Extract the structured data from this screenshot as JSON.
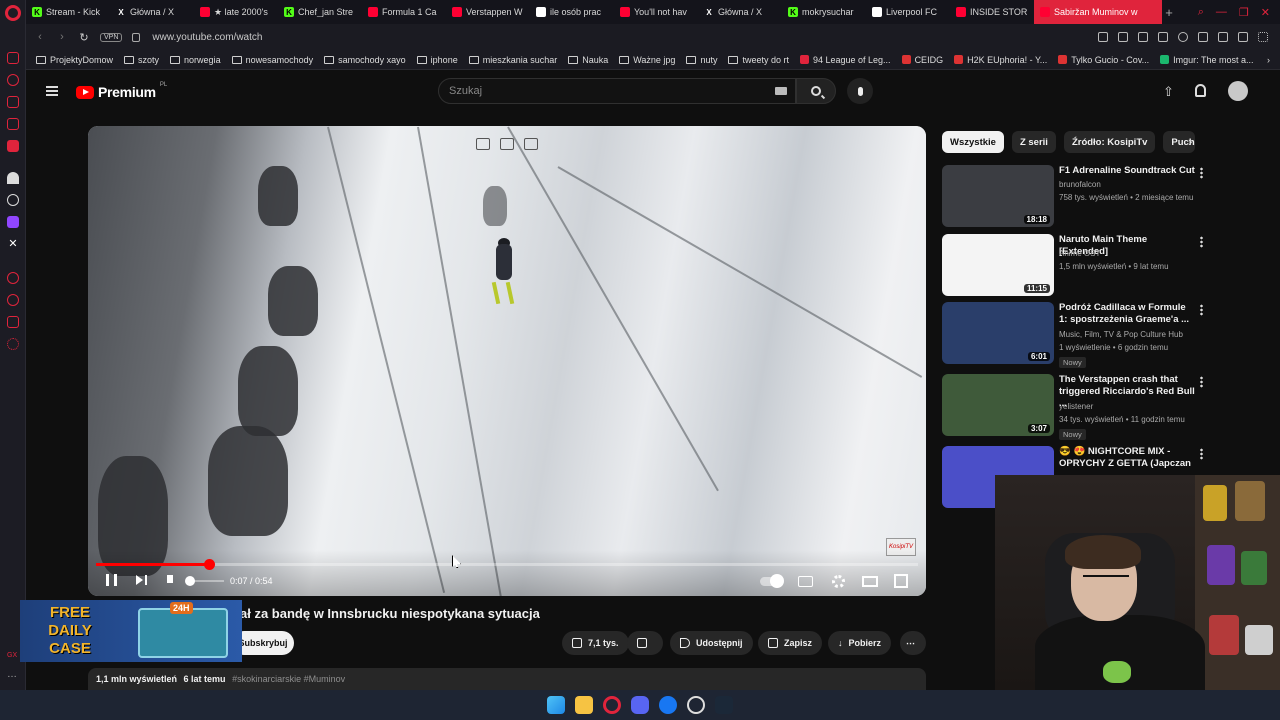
{
  "browser": {
    "tabs": [
      {
        "title": "Stream - Kick",
        "icon": "kick",
        "color": "#53fc18"
      },
      {
        "title": "Główna / X",
        "icon": "x",
        "color": "#ffffff"
      },
      {
        "title": "★ late 2000's",
        "icon": "youtube",
        "color": "#ff0033"
      },
      {
        "title": "Chef_jan Stre",
        "icon": "kick",
        "color": "#53fc18"
      },
      {
        "title": "Formula 1 Ca",
        "icon": "youtube",
        "color": "#ff0033"
      },
      {
        "title": "Verstappen W",
        "icon": "youtube",
        "color": "#ff0033"
      },
      {
        "title": "ile osób prac",
        "icon": "google",
        "color": "#ffffff"
      },
      {
        "title": "You'll not hav",
        "icon": "youtube",
        "color": "#ff0033"
      },
      {
        "title": "Główna / X",
        "icon": "x",
        "color": "#ffffff"
      },
      {
        "title": "mokrysuchar",
        "icon": "kick",
        "color": "#53fc18"
      },
      {
        "title": "Liverpool FC",
        "icon": "premier",
        "color": "#ffffff"
      },
      {
        "title": "INSIDE STOR",
        "icon": "youtube",
        "color": "#ff0033"
      },
      {
        "title": "Sabiržan Muminov w",
        "icon": "youtube",
        "color": "#ff0033",
        "active": true
      }
    ],
    "url": "www.youtube.com/watch",
    "vpn_label": "VPN",
    "bookmarks": [
      {
        "label": "ProjektyDomow",
        "type": "folder"
      },
      {
        "label": "szoty",
        "type": "folder"
      },
      {
        "label": "norwegia",
        "type": "folder"
      },
      {
        "label": "nowesamochody",
        "type": "folder"
      },
      {
        "label": "samochody xayo",
        "type": "folder"
      },
      {
        "label": "iphone",
        "type": "folder"
      },
      {
        "label": "mieszkania suchar",
        "type": "folder"
      },
      {
        "label": "Nauka",
        "type": "folder"
      },
      {
        "label": "Ważne jpg",
        "type": "folder"
      },
      {
        "label": "nuty",
        "type": "folder"
      },
      {
        "label": "tweety do rt",
        "type": "folder"
      },
      {
        "label": "94 League of Leg...",
        "type": "site",
        "color": "#e0243c"
      },
      {
        "label": "CEIDG",
        "type": "site",
        "color": "#d33"
      },
      {
        "label": "H2K EUphoria! - Y...",
        "type": "site",
        "color": "#d33"
      },
      {
        "label": "Tylko Gucio - Cov...",
        "type": "site",
        "color": "#d33"
      },
      {
        "label": "Imgur: The most a...",
        "type": "site",
        "color": "#1bb76e"
      }
    ]
  },
  "youtube": {
    "logo_word": "Premium",
    "logo_region": "PL",
    "search_placeholder": "Szukaj",
    "player": {
      "watermark": "KosipiTV",
      "time_display": "0:07 / 0:54",
      "progress_fraction": 0.138,
      "volume_fraction": 0.1
    },
    "video_title_visible": "ał za bandę w Innsbrucku niespotykana sytuacja",
    "subscribe_label": "Subskrybuj",
    "actions": {
      "like_count": "7,1 tys.",
      "share": "Udostępnij",
      "save": "Zapisz",
      "download": "Pobierz"
    },
    "meta": {
      "views": "1,1 mln wyświetleń",
      "age": "6 lat temu",
      "tags": "#skokinarciarskie #Muminov"
    },
    "chips": [
      "Wszystkie",
      "Z serii",
      "Źródło: KosipiTv",
      "Puch"
    ],
    "recommendations": [
      {
        "title": "F1 Adrenaline Soundtrack Cut",
        "channel": "brunofalcon",
        "stats": "758 tys. wyświetleń • 2 miesiące temu",
        "duration": "18:18",
        "badge": "",
        "thumb": "#3b3d42"
      },
      {
        "title": "Naruto Main Theme [Extended]",
        "channel": "Anime OST",
        "stats": "1,5 mln wyświetleń • 9 lat temu",
        "duration": "11:15",
        "badge": "",
        "thumb": "#f4f4f4"
      },
      {
        "title": "Podróż Cadillaca w Formule 1: spostrzeżenia Graeme'a ...",
        "channel": "Music, Film, TV & Pop Culture Hub",
        "stats": "1 wyświetlenie • 6 godzin temu",
        "duration": "6:01",
        "badge": "Nowy",
        "thumb": "#2a3e6a"
      },
      {
        "title": "The Verstappen crash that triggered Ricciardo's Red Bull ...",
        "channel": "yelistener",
        "stats": "34 tys. wyświetleń • 11 godzin temu",
        "duration": "3:07",
        "badge": "Nowy",
        "thumb": "#3f5a3a"
      },
      {
        "title": "😎 😍 NIGHTCORE MIX - OPRYCHY Z GETTA (Japczan ...",
        "channel": "",
        "stats": "",
        "duration": "",
        "badge": "",
        "thumb": "#4b4fc8"
      }
    ],
    "ad": {
      "line1": "FREE",
      "line2": "DAILY",
      "line3": "CASE",
      "badge": "24H"
    }
  }
}
